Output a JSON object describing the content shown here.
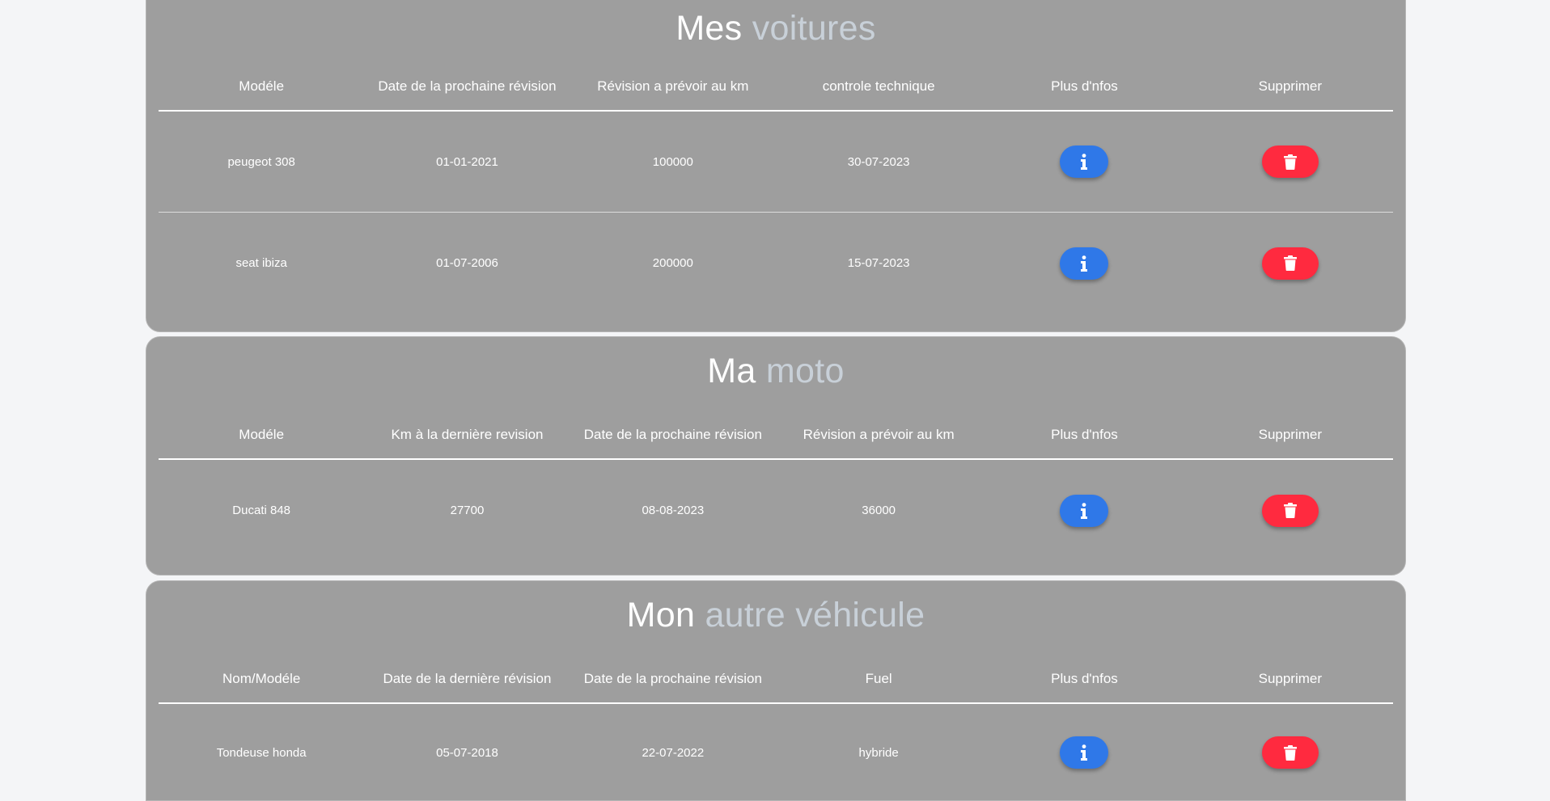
{
  "colors": {
    "background": "#f4f5f7",
    "card": "#9e9e9e",
    "accent_text": "#c8d0d8",
    "info_button": "#2f78e8",
    "delete_button": "#ff2a3f"
  },
  "cars": {
    "title_main": "Mes",
    "title_accent": "voitures",
    "headers": [
      "Modéle",
      "Date de la prochaine révision",
      "Révision a prévoir au km",
      "controle technique",
      "Plus d'nfos",
      "Supprimer"
    ],
    "rows": [
      [
        "peugeot 308",
        "01-01-2021",
        "100000",
        "30-07-2023"
      ],
      [
        "seat ibiza",
        "01-07-2006",
        "200000",
        "15-07-2023"
      ]
    ]
  },
  "moto": {
    "title_main": "Ma",
    "title_accent": "moto",
    "headers": [
      "Modéle",
      "Km à la dernière revision",
      "Date de la prochaine révision",
      "Révision a prévoir au km",
      "Plus d'nfos",
      "Supprimer"
    ],
    "rows": [
      [
        "Ducati 848",
        "27700",
        "08-08-2023",
        "36000"
      ]
    ]
  },
  "other": {
    "title_main": "Mon",
    "title_accent": "autre véhicule",
    "headers": [
      "Nom/Modéle",
      "Date de la dernière révision",
      "Date de la prochaine révision",
      "Fuel",
      "Plus d'nfos",
      "Supprimer"
    ],
    "rows": [
      [
        "Tondeuse honda",
        "05-07-2018",
        "22-07-2022",
        "hybride"
      ]
    ]
  },
  "icons": {
    "info": "info-icon",
    "delete": "trash-icon"
  }
}
